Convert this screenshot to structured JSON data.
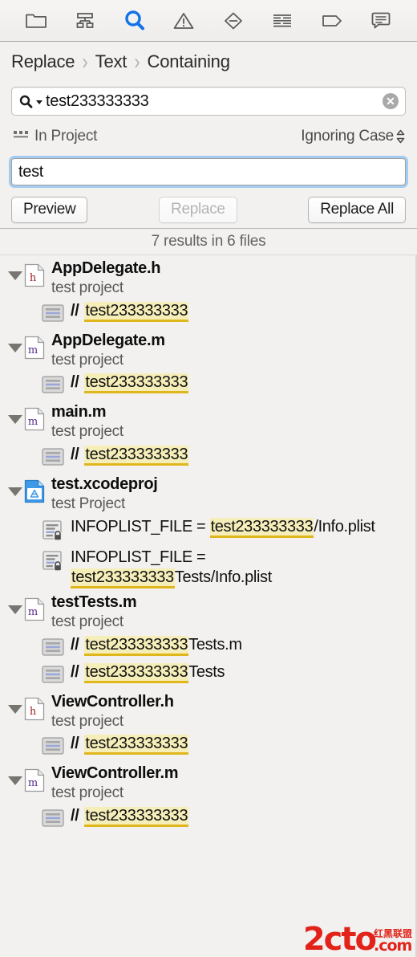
{
  "toolbar": {
    "items": [
      {
        "icon": "folder-icon",
        "name": "project-navigator",
        "active": false
      },
      {
        "icon": "source-control-icon",
        "name": "source-control-navigator",
        "active": false
      },
      {
        "icon": "search-icon",
        "name": "find-navigator",
        "active": true
      },
      {
        "icon": "warning-triangle-icon",
        "name": "issue-navigator",
        "active": false
      },
      {
        "icon": "diamond-minus-icon",
        "name": "test-navigator",
        "active": false
      },
      {
        "icon": "report-lines-icon",
        "name": "debug-navigator",
        "active": false
      },
      {
        "icon": "tag-icon",
        "name": "breakpoint-navigator",
        "active": false
      },
      {
        "icon": "speech-bubble-icon",
        "name": "report-navigator",
        "active": false
      }
    ],
    "accent_color": "#1272e8"
  },
  "breadcrumb": {
    "mode": "Replace",
    "kind": "Text",
    "match": "Containing",
    "separator": "›"
  },
  "search": {
    "value": "test233333333",
    "placeholder": "Search",
    "clear_label": "✕"
  },
  "scope": {
    "left_label": "In Project",
    "right_label": "Ignoring Case"
  },
  "replace": {
    "value": "test",
    "placeholder": "Replace"
  },
  "actions": {
    "preview": "Preview",
    "replace": "Replace",
    "replace_all": "Replace All",
    "replace_disabled": true
  },
  "results_summary": "7 results in 6 files",
  "results": [
    {
      "file": "AppDelegate.h",
      "subtitle": "test project",
      "icon": "h-file-icon",
      "expanded": true,
      "matches": [
        {
          "icon": "code-line-icon",
          "prefix": "//",
          "pre": "",
          "highlight": "test233333333",
          "post": ""
        }
      ]
    },
    {
      "file": "AppDelegate.m",
      "subtitle": "test project",
      "icon": "m-file-icon",
      "expanded": true,
      "matches": [
        {
          "icon": "code-line-icon",
          "prefix": "//",
          "pre": "",
          "highlight": "test233333333",
          "post": ""
        }
      ]
    },
    {
      "file": "main.m",
      "subtitle": "test project",
      "icon": "m-file-icon",
      "expanded": true,
      "matches": [
        {
          "icon": "code-line-icon",
          "prefix": "//",
          "pre": "",
          "highlight": "test233333333",
          "post": ""
        }
      ]
    },
    {
      "file": "test.xcodeproj",
      "subtitle": "test Project",
      "icon": "xcode-project-icon",
      "expanded": true,
      "matches": [
        {
          "icon": "locked-settings-icon",
          "prefix": "",
          "pre": "INFOPLIST_FILE = ",
          "highlight": "test233333333",
          "post": "/Info.plist"
        },
        {
          "icon": "locked-settings-icon",
          "prefix": "",
          "pre": "INFOPLIST_FILE = ",
          "highlight": "test233333333",
          "post": "Tests/Info.plist"
        }
      ]
    },
    {
      "file": "testTests.m",
      "subtitle": "test project",
      "icon": "m-file-icon",
      "expanded": true,
      "matches": [
        {
          "icon": "code-line-icon",
          "prefix": "//",
          "pre": "",
          "highlight": "test233333333",
          "post": "Tests.m"
        },
        {
          "icon": "code-line-icon",
          "prefix": "//",
          "pre": "",
          "highlight": "test233333333",
          "post": "Tests"
        }
      ]
    },
    {
      "file": "ViewController.h",
      "subtitle": "test project",
      "icon": "h-file-icon",
      "expanded": true,
      "matches": [
        {
          "icon": "code-line-icon",
          "prefix": "//",
          "pre": "",
          "highlight": "test233333333",
          "post": ""
        }
      ]
    },
    {
      "file": "ViewController.m",
      "subtitle": "test project",
      "icon": "m-file-icon",
      "expanded": true,
      "matches": [
        {
          "icon": "code-line-icon",
          "prefix": "//",
          "pre": "",
          "highlight": "test233333333",
          "post": ""
        }
      ]
    }
  ],
  "watermark": {
    "main": "2cto",
    "cn": "红黑联盟",
    "com": ".com",
    "color": "#e2231a"
  }
}
